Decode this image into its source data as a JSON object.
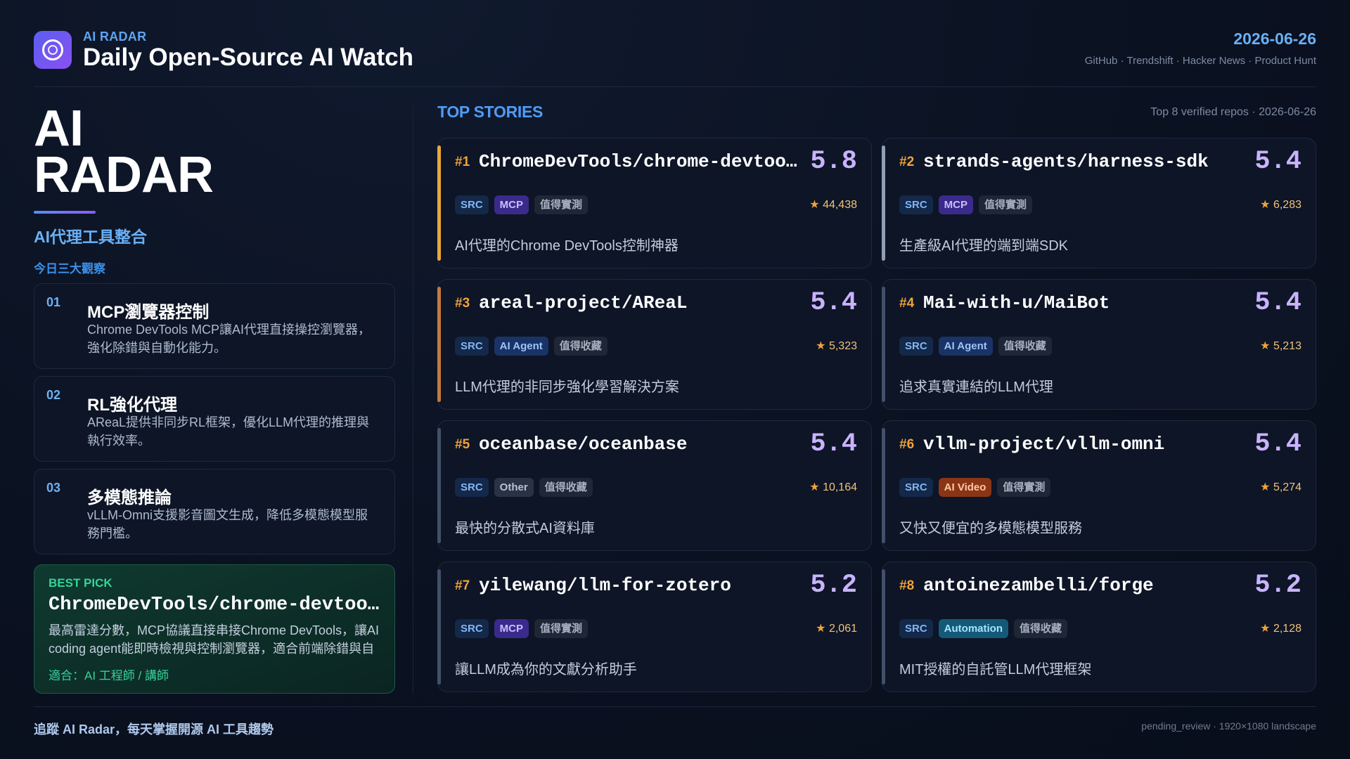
{
  "header": {
    "brand_small": "AI RADAR",
    "title": "Daily Open-Source AI Watch",
    "date": "2026-06-26",
    "sources": "GitHub · Trendshift · Hacker News · Product Hunt"
  },
  "left": {
    "big_title_1": "AI",
    "big_title_2": "RADAR",
    "subtitle": "AI代理工具整合",
    "insights_label": "今日三大觀察",
    "insights": [
      {
        "num": "01",
        "title": "MCP瀏覽器控制",
        "desc": "Chrome DevTools MCP讓AI代理直接操控瀏覽器，強化除錯與自動化能力。"
      },
      {
        "num": "02",
        "title": "RL強化代理",
        "desc": "AReaL提供非同步RL框架，優化LLM代理的推理與執行效率。"
      },
      {
        "num": "03",
        "title": "多模態推論",
        "desc": "vLLM-Omni支援影音圖文生成，降低多模態模型服務門檻。"
      }
    ],
    "best_pick": {
      "label": "BEST PICK",
      "name": "ChromeDevTools/chrome-devtools-mcp",
      "desc": "最高雷達分數，MCP協議直接串接Chrome DevTools，讓AI coding agent能即時檢視與控制瀏覽器，適合前端除錯與自動化測試。",
      "fit": "適合：AI 工程師 / 講師"
    }
  },
  "top": {
    "label": "TOP STORIES",
    "meta": "Top 8 verified repos · 2026-06-26",
    "cards": [
      {
        "rank": "#1",
        "name": "ChromeDevTools/chrome-devtools-mcp",
        "score": "5.8",
        "tags": [
          "SRC",
          "MCP",
          "值得實測"
        ],
        "stars": "44,438",
        "desc": "AI代理的Chrome DevTools控制神器"
      },
      {
        "rank": "#2",
        "name": "strands-agents/harness-sdk",
        "score": "5.4",
        "tags": [
          "SRC",
          "MCP",
          "值得實測"
        ],
        "stars": "6,283",
        "desc": "生產級AI代理的端到端SDK"
      },
      {
        "rank": "#3",
        "name": "areal-project/AReaL",
        "score": "5.4",
        "tags": [
          "SRC",
          "AI Agent",
          "值得收藏"
        ],
        "stars": "5,323",
        "desc": "LLM代理的非同步強化學習解決方案"
      },
      {
        "rank": "#4",
        "name": "Mai-with-u/MaiBot",
        "score": "5.4",
        "tags": [
          "SRC",
          "AI Agent",
          "值得收藏"
        ],
        "stars": "5,213",
        "desc": "追求真實連結的LLM代理"
      },
      {
        "rank": "#5",
        "name": "oceanbase/oceanbase",
        "score": "5.4",
        "tags": [
          "SRC",
          "Other",
          "值得收藏"
        ],
        "stars": "10,164",
        "desc": "最快的分散式AI資料庫"
      },
      {
        "rank": "#6",
        "name": "vllm-project/vllm-omni",
        "score": "5.4",
        "tags": [
          "SRC",
          "AI Video",
          "值得實測"
        ],
        "stars": "5,274",
        "desc": "又快又便宜的多模態模型服務"
      },
      {
        "rank": "#7",
        "name": "yilewang/llm-for-zotero",
        "score": "5.2",
        "tags": [
          "SRC",
          "MCP",
          "值得實測"
        ],
        "stars": "2,061",
        "desc": "讓LLM成為你的文獻分析助手"
      },
      {
        "rank": "#8",
        "name": "antoinezambelli/forge",
        "score": "5.2",
        "tags": [
          "SRC",
          "Automation",
          "值得收藏"
        ],
        "stars": "2,128",
        "desc": "MIT授權的自託管LLM代理框架"
      }
    ]
  },
  "footer": {
    "left": "追蹤 AI Radar，每天掌握開源 AI 工具趨勢",
    "right": "pending_review · 1920×1080 landscape"
  },
  "colors": {
    "accent": "#4f9cf5",
    "score": "#c9b3ff",
    "rank": "#f0a33a",
    "best": "#36d399"
  }
}
